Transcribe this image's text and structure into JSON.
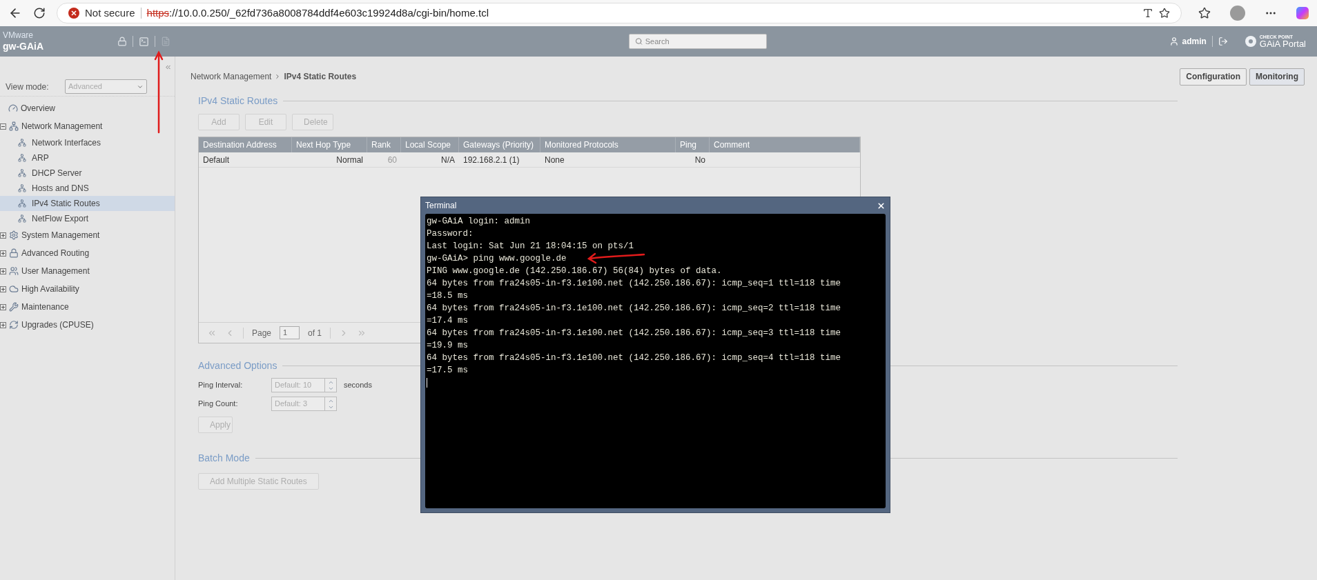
{
  "browser": {
    "security_label": "Not secure",
    "url_scheme": "https",
    "url_rest": "://10.0.0.250/_62fd736a8008784ddf4e603c19924d8a/cgi-bin/home.tcl"
  },
  "header": {
    "vendor": "VMware",
    "hostname": "gw-GAiA",
    "search_placeholder": "Search",
    "user": "admin",
    "brand_small": "CHECK POINT",
    "brand": "GAiA Portal"
  },
  "sidebar": {
    "view_mode_label": "View mode:",
    "view_mode_value": "Advanced",
    "items": [
      {
        "label": "Overview",
        "kind": "page",
        "selected": false
      },
      {
        "label": "Network Management",
        "kind": "group",
        "expanded": true,
        "selected": false,
        "children": [
          {
            "label": "Network Interfaces",
            "selected": false
          },
          {
            "label": "ARP",
            "selected": false
          },
          {
            "label": "DHCP Server",
            "selected": false
          },
          {
            "label": "Hosts and DNS",
            "selected": false
          },
          {
            "label": "IPv4 Static Routes",
            "selected": true
          },
          {
            "label": "NetFlow Export",
            "selected": false
          }
        ]
      },
      {
        "label": "System Management",
        "kind": "group",
        "expanded": false,
        "selected": false
      },
      {
        "label": "Advanced Routing",
        "kind": "group",
        "expanded": false,
        "selected": false
      },
      {
        "label": "User Management",
        "kind": "group",
        "expanded": false,
        "selected": false
      },
      {
        "label": "High Availability",
        "kind": "group",
        "expanded": false,
        "selected": false
      },
      {
        "label": "Maintenance",
        "kind": "group",
        "expanded": false,
        "selected": false
      },
      {
        "label": "Upgrades (CPUSE)",
        "kind": "group",
        "expanded": false,
        "selected": false
      }
    ]
  },
  "breadcrumb": [
    "Network Management",
    "IPv4 Static Routes"
  ],
  "mode_buttons": [
    "Configuration",
    "Monitoring"
  ],
  "routes_section": {
    "title": "IPv4 Static Routes",
    "buttons": [
      {
        "label": "Add",
        "disabled": true
      },
      {
        "label": "Edit",
        "disabled": true
      },
      {
        "label": "Delete",
        "disabled": true
      }
    ]
  },
  "table": {
    "columns": [
      "Destination Address",
      "Next Hop Type",
      "Rank",
      "Local Scope",
      "Gateways (Priority)",
      "Monitored Protocols",
      "Ping",
      "Comment"
    ],
    "rows": [
      [
        "Default",
        "Normal",
        "60",
        "N/A",
        "192.168.2.1 (1)",
        "None",
        "No",
        ""
      ]
    ]
  },
  "pager": {
    "page_label": "Page",
    "page_value": "1",
    "of_label": "of 1"
  },
  "advanced_options": {
    "title": "Advanced Options",
    "fields": [
      {
        "label": "Ping Interval:",
        "placeholder": "Default: 10",
        "unit": "seconds"
      },
      {
        "label": "Ping Count:",
        "placeholder": "Default: 3"
      }
    ],
    "apply": {
      "label": "Apply",
      "disabled": true
    }
  },
  "batch_mode": {
    "title": "Batch Mode",
    "button": {
      "label": "Add Multiple Static Routes",
      "disabled": true
    }
  },
  "terminal": {
    "title": "Terminal",
    "lines": [
      "gw-GAiA login: admin",
      "Password:",
      "Last login: Sat Jun 21 18:04:15 on pts/1",
      "gw-GAiA> ping www.google.de",
      "PING www.google.de (142.250.186.67) 56(84) bytes of data.",
      "64 bytes from fra24s05-in-f3.1e100.net (142.250.186.67): icmp_seq=1 ttl=118 time",
      "=18.5 ms",
      "64 bytes from fra24s05-in-f3.1e100.net (142.250.186.67): icmp_seq=2 ttl=118 time",
      "=17.4 ms",
      "64 bytes from fra24s05-in-f3.1e100.net (142.250.186.67): icmp_seq=3 ttl=118 time",
      "=19.9 ms",
      "64 bytes from fra24s05-in-f3.1e100.net (142.250.186.67): icmp_seq=4 ttl=118 time",
      "=17.5 ms"
    ]
  }
}
